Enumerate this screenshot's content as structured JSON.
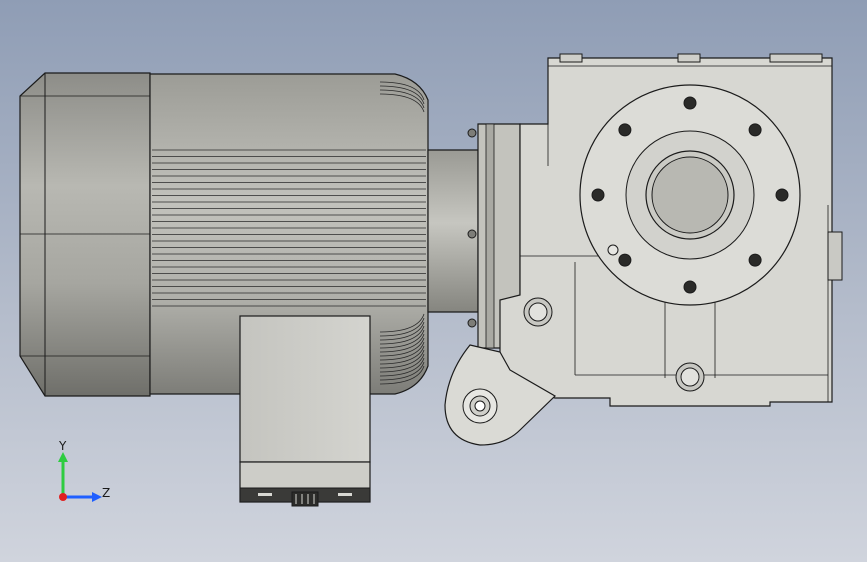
{
  "viewport": {
    "background_top": "#8f9db5",
    "background_bottom": "#d0d4dd",
    "part_color": "#d7d7d2",
    "motor_color": "#b4b4ad",
    "edge_color": "#1b1b1b"
  },
  "triad": {
    "y_label": "Y",
    "z_label": "Z",
    "y_color": "#2ecc40",
    "z_color": "#1f5fff",
    "x_color": "#e02020"
  }
}
